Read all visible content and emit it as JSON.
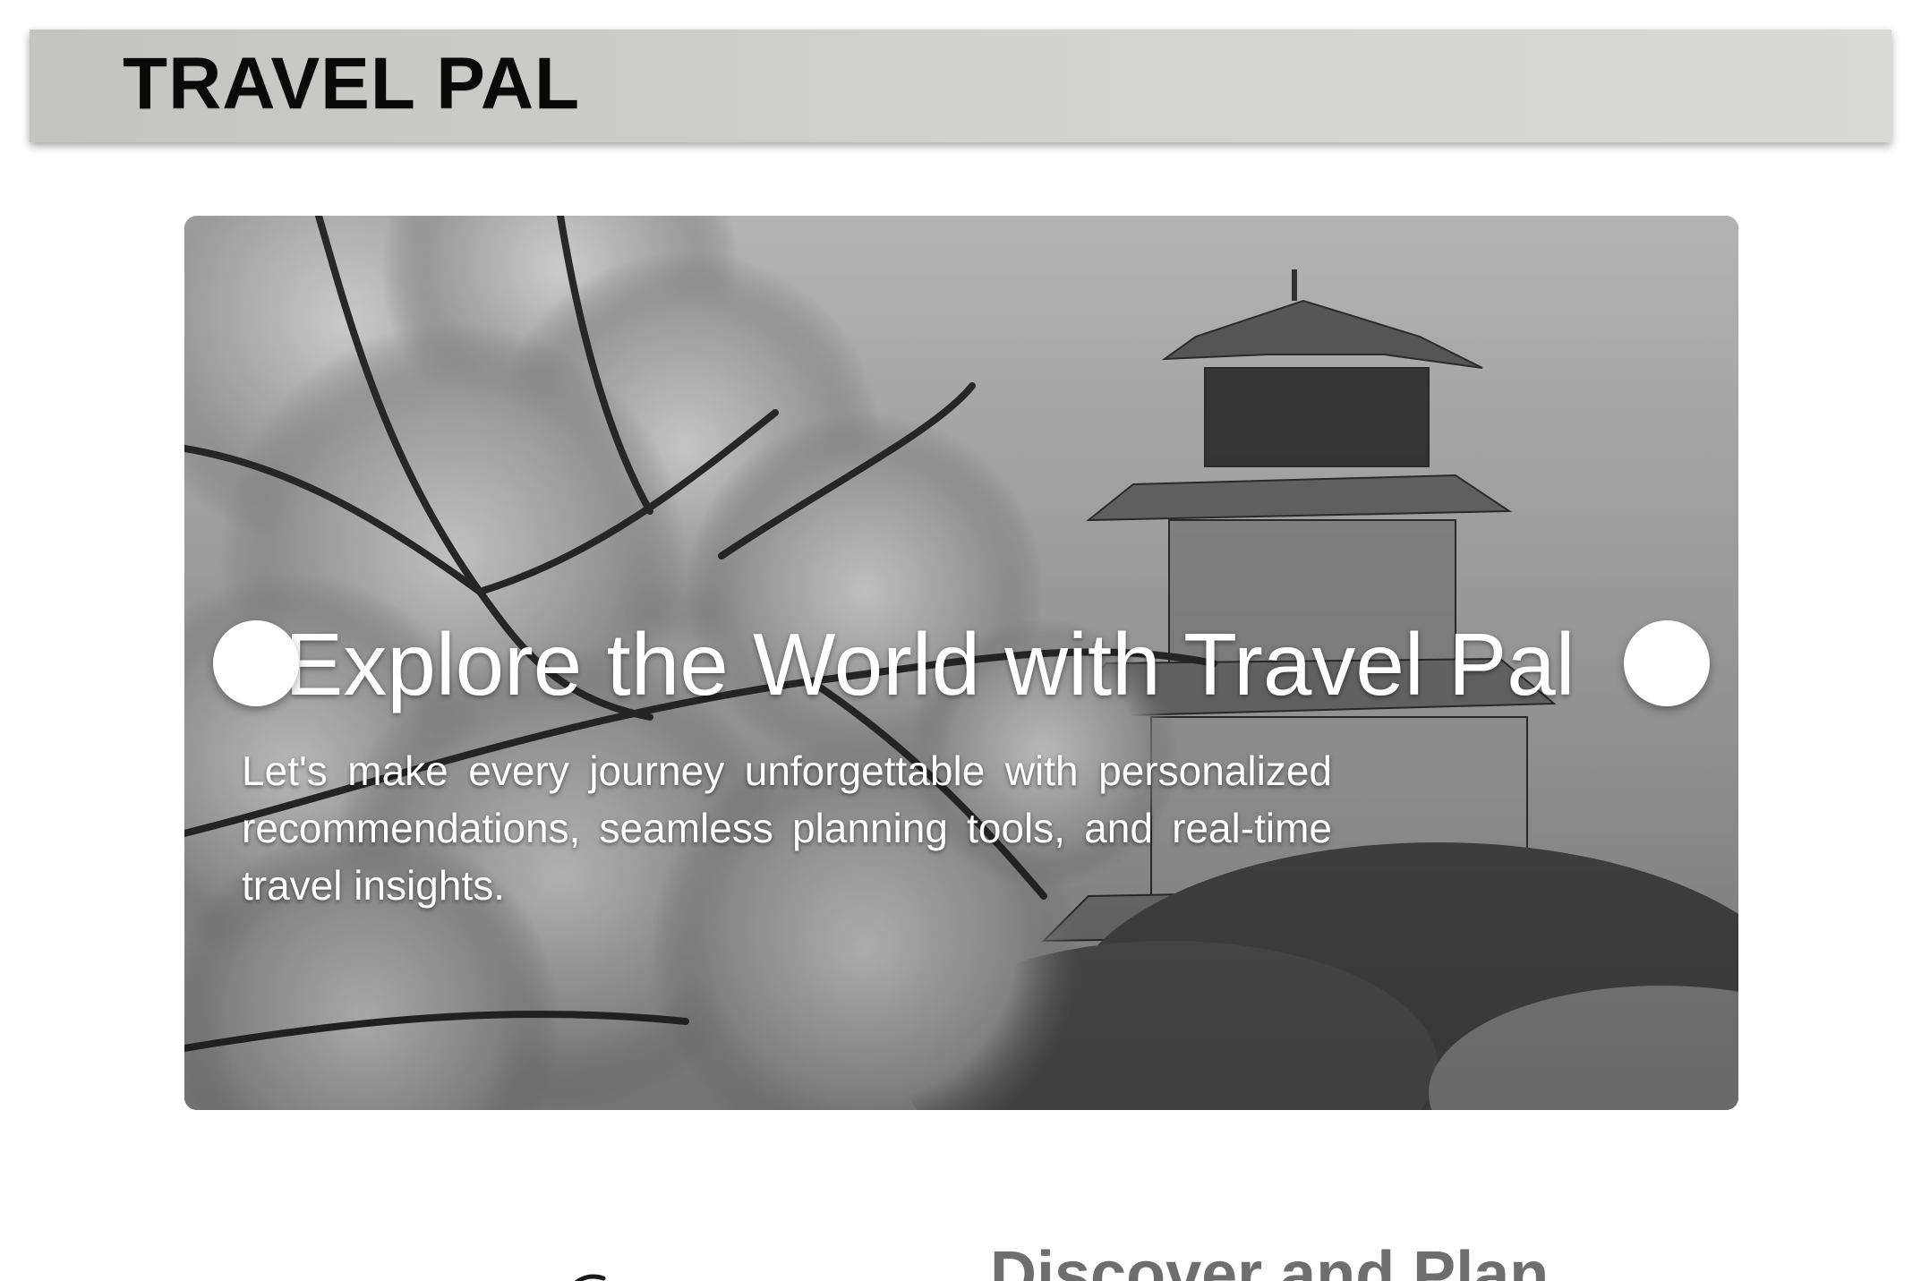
{
  "header": {
    "brand": "TRAVEL PAL"
  },
  "hero": {
    "title": "Explore the World with Travel Pal",
    "description": "Let's make every journey unforgettable with personalized recommendations, seamless planning tools, and real-time travel insights.",
    "prev_icon": "circle-prev-icon",
    "next_icon": "circle-next-icon"
  },
  "section": {
    "heading": "Discover and Plan"
  },
  "colors": {
    "header_bg": "#cbcbc9",
    "brand_text": "#0a0a0a",
    "hero_text": "#ffffff",
    "section_heading": "#6e6e6e"
  }
}
